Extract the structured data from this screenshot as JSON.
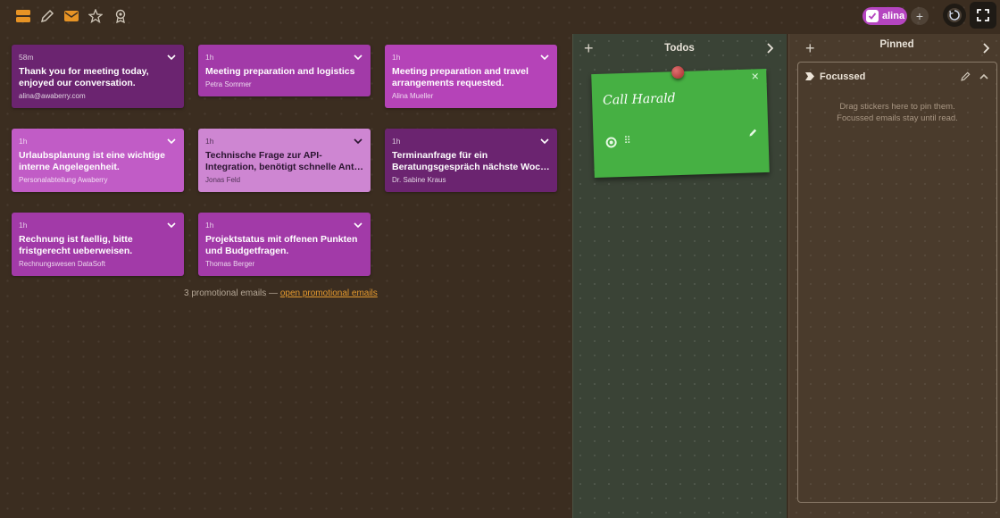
{
  "toolbar": {
    "icons": [
      "stack-icon",
      "pencil-icon",
      "mail-icon",
      "star-icon",
      "award-icon"
    ],
    "user": "alina"
  },
  "emails": [
    {
      "time": "58m",
      "subject": "Thank you for meeting today, enjoyed our conversation.",
      "sender": "alina@awaberry.com"
    },
    {
      "time": "1h",
      "subject": "Meeting preparation and logistics",
      "sender": "Petra Sommer"
    },
    {
      "time": "1h",
      "subject": "Meeting preparation and travel arrangements requested.",
      "sender": "Alina Mueller"
    },
    {
      "time": "1h",
      "subject": "Urlaubsplanung ist eine wichtige interne Angelegenheit.",
      "sender": "Personalabteilung Awaberry"
    },
    {
      "time": "1h",
      "subject": "Technische Frage zur API-Integration, benötigt schnelle Ant…",
      "sender": "Jonas Feld"
    },
    {
      "time": "1h",
      "subject": "Terminanfrage für ein Beratungsgespräch nächste Woc…",
      "sender": "Dr. Sabine Kraus"
    },
    {
      "time": "1h",
      "subject": "Rechnung ist faellig, bitte fristgerecht ueberweisen.",
      "sender": "Rechnungswesen DataSoft"
    },
    {
      "time": "1h",
      "subject": "Projektstatus mit offenen Punkten und Budgetfragen.",
      "sender": "Thomas Berger"
    }
  ],
  "promo": {
    "text": "3 promotional emails — ",
    "link": "open promotional emails"
  },
  "todos": {
    "title": "Todos",
    "sticky": {
      "text": "Call Harald",
      "color": "#46b043"
    }
  },
  "pinned": {
    "title": "Pinned",
    "section": "Focussed",
    "hint_line1": "Drag stickers here to pin them.",
    "hint_line2": "Focussed emails stay until read."
  },
  "colors": {
    "accent_orange": "#e59a2e",
    "user_chip": "#b545c0"
  }
}
